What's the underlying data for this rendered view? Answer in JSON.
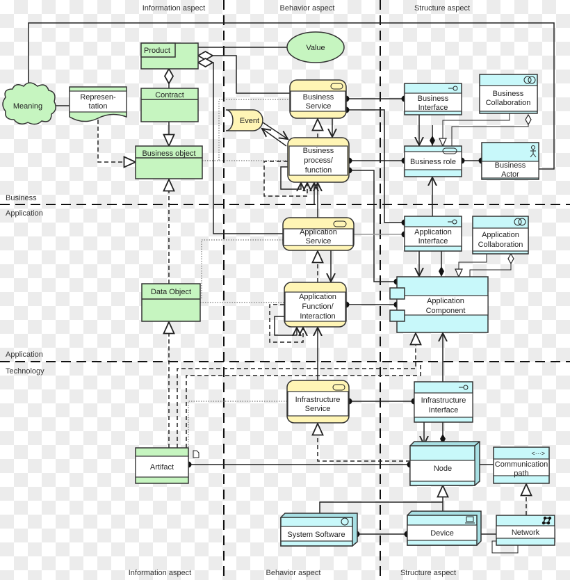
{
  "colors": {
    "information": "#c6f5c0",
    "behavior": "#fff5b5",
    "structure": "#c8f8fa",
    "line": "#222222"
  },
  "columns": {
    "information": "Information aspect",
    "behavior": "Behavior aspect",
    "structure": "Structure aspect"
  },
  "layers": {
    "business": "Business",
    "application_top": "Application",
    "application_bottom": "Application",
    "technology": "Technology"
  },
  "elements": {
    "product": "Product",
    "value": "Value",
    "meaning": "Meaning",
    "representation": [
      "Represen-",
      "tation"
    ],
    "contract": "Contract",
    "business_object": "Business object",
    "business_service": [
      "Business",
      "Service"
    ],
    "event": "Event",
    "business_process": [
      "Business",
      "process/",
      "function"
    ],
    "business_interface": [
      "Business",
      "Interface"
    ],
    "business_collaboration": [
      "Business",
      "Collaboration"
    ],
    "business_role": "Business role",
    "business_actor": [
      "Business",
      "Actor"
    ],
    "application_service": [
      "Application",
      "Service"
    ],
    "application_interface": [
      "Application",
      "Interface"
    ],
    "application_collaboration": [
      "Application",
      "Collaboration"
    ],
    "data_object": "Data Object",
    "application_function": [
      "Application",
      "Function/",
      "Interaction"
    ],
    "application_component": [
      "Application",
      "Component"
    ],
    "infrastructure_service": [
      "Infrastructure",
      "Service"
    ],
    "infrastructure_interface": [
      "Infrastructure",
      "Interface"
    ],
    "artifact": "Artifact",
    "node": "Node",
    "communication_path": [
      "Communication",
      "path"
    ],
    "system_software": "System Software",
    "device": "Device",
    "network": "Network"
  },
  "icons": [
    "interface-icon",
    "collaboration-icon",
    "role-icon",
    "actor-icon",
    "service-icon",
    "component-icon",
    "artifact-icon",
    "communication-path-icon",
    "system-software-icon",
    "device-icon",
    "network-icon"
  ]
}
